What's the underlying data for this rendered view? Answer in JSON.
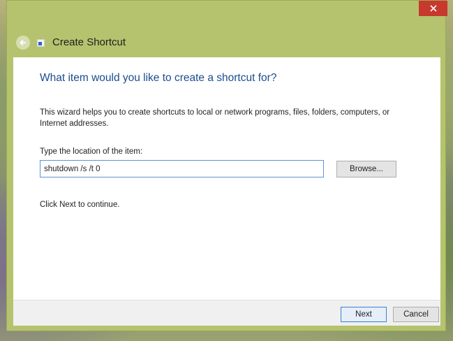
{
  "window": {
    "title": "Create Shortcut",
    "accent_color": "#b5c36e",
    "close_icon": "close-icon",
    "back_icon": "back-arrow-icon"
  },
  "wizard": {
    "heading": "What item would you like to create a shortcut for?",
    "description": "This wizard helps you to create shortcuts to local or network programs, files, folders, computers, or Internet addresses.",
    "location_label": "Type the location of the item:",
    "location_value": "shutdown /s /t 0",
    "browse_label": "Browse...",
    "continue_text": "Click Next to continue."
  },
  "footer": {
    "next_label": "Next",
    "cancel_label": "Cancel"
  }
}
